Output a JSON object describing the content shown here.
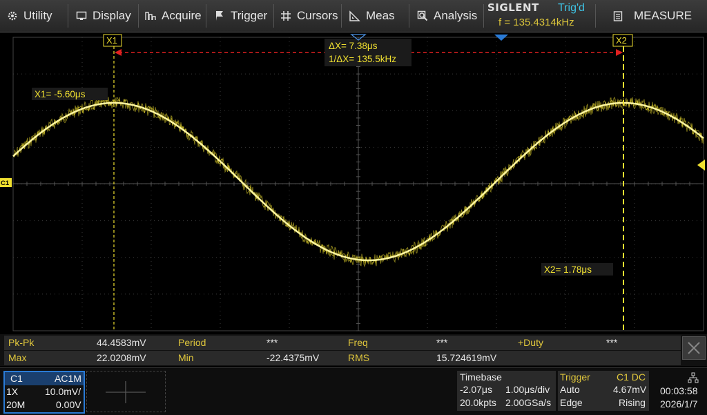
{
  "menu": {
    "items": [
      {
        "label": "Utility",
        "icon": "gear-icon"
      },
      {
        "label": "Display",
        "icon": "monitor-icon"
      },
      {
        "label": "Acquire",
        "icon": "acquire-icon"
      },
      {
        "label": "Trigger",
        "icon": "flag-icon"
      },
      {
        "label": "Cursors",
        "icon": "crosshair-icon"
      },
      {
        "label": "Meas",
        "icon": "ruler-icon"
      },
      {
        "label": "Analysis",
        "icon": "analysis-icon"
      }
    ],
    "brand": "SIGLENT",
    "trigger_state": "Trig'd",
    "freq_readout": "f = 135.4314kHz",
    "measure_label": "MEASURE"
  },
  "cursors": {
    "x1_tag": "X1",
    "x2_tag": "X2",
    "x1_readout": "X1= -5.60μs",
    "x2_readout": "X2= 1.78μs",
    "delta_x": "ΔX= 7.38μs",
    "inv_delta_x": "1/ΔX= 135.5kHz"
  },
  "channel_marker": "C1",
  "colors": {
    "trace": "#f0e030",
    "cursor": "#f0e030",
    "delta_arrow": "#e02020",
    "accent_blue": "#2a7bd6",
    "trig_state": "#3ec4e6"
  },
  "measurements": {
    "row1": [
      {
        "label": "Pk-Pk",
        "value": "44.4583mV"
      },
      {
        "label": "Period",
        "value": "***"
      },
      {
        "label": "Freq",
        "value": "***"
      },
      {
        "label": "+Duty",
        "value": "***"
      }
    ],
    "row2": [
      {
        "label": "Max",
        "value": "22.0208mV"
      },
      {
        "label": "Min",
        "value": "-22.4375mV"
      },
      {
        "label": "RMS",
        "value": "15.724619mV"
      }
    ]
  },
  "channel1": {
    "name": "C1",
    "coupling": "AC1M",
    "probe": "1X",
    "scale": "10.0mV/",
    "bandwidth": "20M",
    "offset": "0.00V"
  },
  "timebase": {
    "title": "Timebase",
    "delay": "-2.07μs",
    "scale": "1.00μs/div",
    "points": "20.0kpts",
    "sample_rate": "2.00GSa/s"
  },
  "trigger": {
    "title": "Trigger",
    "source": "C1 DC",
    "mode": "Auto",
    "level": "4.67mV",
    "type": "Edge",
    "slope": "Rising"
  },
  "clock": {
    "time": "00:03:58",
    "date": "2026/1/7"
  }
}
